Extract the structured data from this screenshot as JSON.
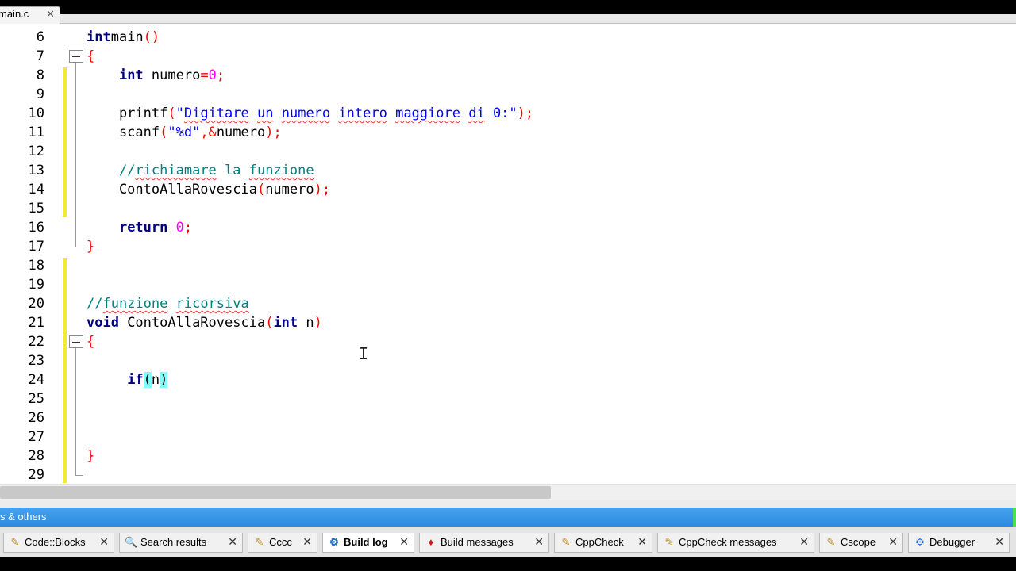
{
  "editor_tab": {
    "label": "main.c",
    "close": "✕"
  },
  "lines": [
    {
      "n": "6",
      "segs": [
        [
          "kw",
          "int"
        ],
        [
          "",
          "main"
        ],
        [
          "op",
          "()"
        ]
      ]
    },
    {
      "n": "7",
      "segs": [
        [
          "op",
          "{"
        ]
      ]
    },
    {
      "n": "8",
      "segs": [
        [
          "",
          "    "
        ],
        [
          "kw",
          "int"
        ],
        [
          "",
          " numero"
        ],
        [
          "op",
          "="
        ],
        [
          "num",
          "0"
        ],
        [
          "op",
          ";"
        ]
      ]
    },
    {
      "n": "9",
      "segs": []
    },
    {
      "n": "10",
      "segs": [
        [
          "",
          "    printf"
        ],
        [
          "op",
          "("
        ],
        [
          "str",
          "\""
        ],
        [
          "str sq",
          "Digitare"
        ],
        [
          "str",
          " "
        ],
        [
          "str sq",
          "un"
        ],
        [
          "str",
          " "
        ],
        [
          "str sq",
          "numero"
        ],
        [
          "str",
          " "
        ],
        [
          "str sq",
          "intero"
        ],
        [
          "str",
          " "
        ],
        [
          "str sq",
          "maggiore"
        ],
        [
          "str",
          " "
        ],
        [
          "str sq",
          "di"
        ],
        [
          "str",
          " 0:\""
        ],
        [
          "op",
          ");"
        ]
      ]
    },
    {
      "n": "11",
      "segs": [
        [
          "",
          "    scanf"
        ],
        [
          "op",
          "("
        ],
        [
          "str",
          "\"%d\""
        ],
        [
          "op",
          ",&"
        ],
        [
          "",
          "numero"
        ],
        [
          "op",
          ");"
        ]
      ]
    },
    {
      "n": "12",
      "segs": []
    },
    {
      "n": "13",
      "segs": [
        [
          "",
          "    "
        ],
        [
          "cmt",
          "//"
        ],
        [
          "cmt sq",
          "richiamare"
        ],
        [
          "cmt",
          " la "
        ],
        [
          "cmt sq",
          "funzione"
        ]
      ]
    },
    {
      "n": "14",
      "segs": [
        [
          "",
          "    ContoAllaRovescia"
        ],
        [
          "op",
          "("
        ],
        [
          "",
          "numero"
        ],
        [
          "op",
          ");"
        ]
      ]
    },
    {
      "n": "15",
      "segs": []
    },
    {
      "n": "16",
      "segs": [
        [
          "",
          "    "
        ],
        [
          "kw",
          "return"
        ],
        [
          "",
          " "
        ],
        [
          "num",
          "0"
        ],
        [
          "op",
          ";"
        ]
      ]
    },
    {
      "n": "17",
      "segs": [
        [
          "op",
          "}"
        ]
      ]
    },
    {
      "n": "18",
      "segs": []
    },
    {
      "n": "19",
      "segs": []
    },
    {
      "n": "20",
      "segs": [
        [
          "cmt",
          "//"
        ],
        [
          "cmt sq",
          "funzione"
        ],
        [
          "cmt",
          " "
        ],
        [
          "cmt sq",
          "ricorsiva"
        ]
      ]
    },
    {
      "n": "21",
      "segs": [
        [
          "kw",
          "void"
        ],
        [
          "",
          " ContoAllaRovescia"
        ],
        [
          "op",
          "("
        ],
        [
          "kw",
          "int"
        ],
        [
          "",
          " n"
        ],
        [
          "op",
          ")"
        ]
      ]
    },
    {
      "n": "22",
      "segs": [
        [
          "op",
          "{"
        ]
      ]
    },
    {
      "n": "23",
      "segs": []
    },
    {
      "n": "24",
      "segs": [
        [
          "",
          "     "
        ],
        [
          "kw",
          "if"
        ],
        [
          "hl",
          "("
        ],
        [
          "",
          "n"
        ],
        [
          "hl",
          ")"
        ]
      ]
    },
    {
      "n": "25",
      "segs": []
    },
    {
      "n": "26",
      "segs": []
    },
    {
      "n": "27",
      "segs": []
    },
    {
      "n": "28",
      "segs": [
        [
          "op",
          "}"
        ]
      ]
    },
    {
      "n": "29",
      "segs": []
    }
  ],
  "logs_panel": {
    "title": "s & others"
  },
  "bottom_tabs": [
    {
      "label": "Code::Blocks",
      "icon": "pencil-icon",
      "glyph": "✎",
      "active": false
    },
    {
      "label": "Search results",
      "icon": "search-icon",
      "glyph": "🔍",
      "active": false
    },
    {
      "label": "Cccc",
      "icon": "pencil-icon",
      "glyph": "✎",
      "active": false
    },
    {
      "label": "Build log",
      "icon": "gear-icon",
      "glyph": "⚙",
      "active": true
    },
    {
      "label": "Build messages",
      "icon": "ruby-icon",
      "glyph": "♦",
      "active": false
    },
    {
      "label": "CppCheck",
      "icon": "pencil-icon",
      "glyph": "✎",
      "active": false
    },
    {
      "label": "CppCheck messages",
      "icon": "pencil-icon",
      "glyph": "✎",
      "active": false
    },
    {
      "label": "Cscope",
      "icon": "pencil-icon",
      "glyph": "✎",
      "active": false
    },
    {
      "label": "Debugger",
      "icon": "bug-icon",
      "glyph": "⚙",
      "active": false
    }
  ],
  "tab_close_glyph": "✕",
  "colors": {
    "keyword": "#000080",
    "string": "#0000ff",
    "operator": "#ff0000",
    "number": "#ff00ff",
    "comment": "#008080",
    "changebar": "#f2ea2f",
    "panel_header": "#2b8be0"
  }
}
